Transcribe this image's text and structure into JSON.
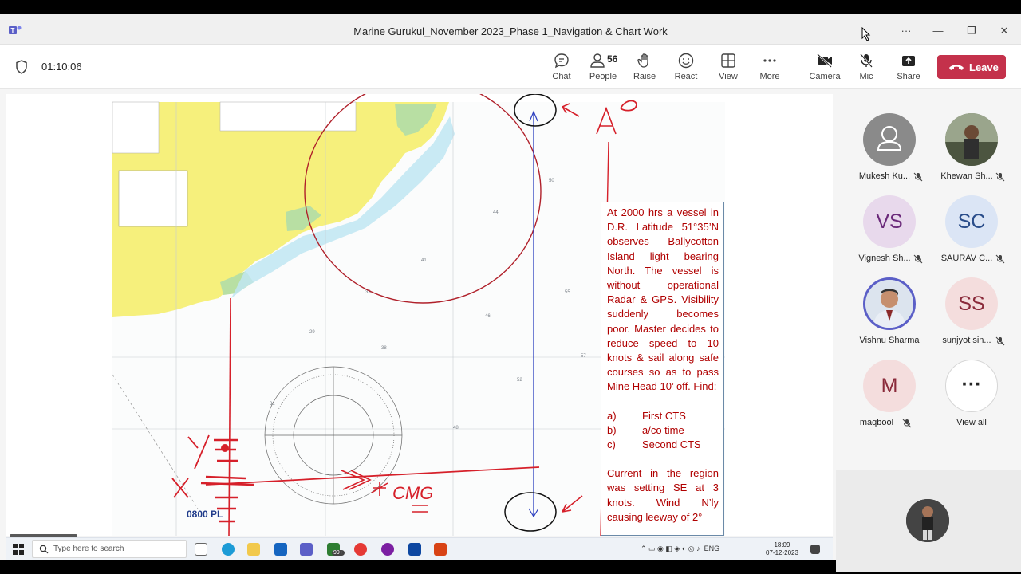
{
  "window": {
    "title": "Marine Gurukul_November 2023_Phase 1_Navigation & Chart Work",
    "controls": [
      "more-options",
      "minimize",
      "maximize",
      "close"
    ]
  },
  "toolbar": {
    "timer": "01:10:06",
    "chat_label": "Chat",
    "people_label": "People",
    "people_count": "56",
    "raise_label": "Raise",
    "react_label": "React",
    "view_label": "View",
    "more_label": "More",
    "camera_label": "Camera",
    "mic_label": "Mic",
    "share_label": "Share",
    "leave_label": "Leave",
    "leave_color": "#c4314b"
  },
  "stage": {
    "problem_text": "At 2000 hrs a vessel in D.R. Latitude 51°35’N observes Ballycotton Island light bearing North. The vessel is without operational Radar & GPS. Visibility suddenly becomes poor. Master decides to reduce speed to 10 knots & sail along safe courses so as to pass Mine Head 10’ off. Find:",
    "answers": [
      {
        "key": "a)",
        "text": "First CTS"
      },
      {
        "key": "b)",
        "text": "a/co time"
      },
      {
        "key": "c)",
        "text": "Second CTS"
      }
    ],
    "current_text": "Current in the region was setting SE at 3 knots. Wind N’ly causing leeway of 2°",
    "position_label": "0800 PL",
    "chart_annotation": "CMG",
    "presenter_name": "Vishnu Sharma"
  },
  "participants": [
    {
      "name": "Mukesh Ku...",
      "initials": "",
      "avatar": "generic-person-icon",
      "bg": "#8a8a8a",
      "muted": true
    },
    {
      "name": "Khewan Sh...",
      "initials": "",
      "avatar": "photo",
      "bg": "#6b7a5a",
      "muted": true
    },
    {
      "name": "Vignesh Sh...",
      "initials": "VS",
      "bg": "#e8d9ec",
      "fg": "#6b2a7a",
      "muted": true
    },
    {
      "name": "SAURAV C...",
      "initials": "SC",
      "bg": "#dbe5f5",
      "fg": "#2a4d8a",
      "muted": true
    },
    {
      "name": "Vishnu Sharma",
      "initials": "",
      "avatar": "photo",
      "bg": "#c9d6ea",
      "muted": false,
      "speaking": true
    },
    {
      "name": "sunjyot sin...",
      "initials": "SS",
      "bg": "#f4dddd",
      "fg": "#8a2a3a",
      "muted": true
    },
    {
      "name": "maqbool",
      "initials": "M",
      "bg": "#f4dddd",
      "fg": "#8a2a3a",
      "muted": true
    },
    {
      "name": "View all",
      "initials": "···",
      "bg": "#ffffff",
      "fg": "#242424",
      "muted": false
    }
  ],
  "taskbar": {
    "search_placeholder": "Type here to search",
    "tray_lang": "ENG",
    "time": "18:09",
    "date": "07-12-2023",
    "badge": "99+"
  }
}
